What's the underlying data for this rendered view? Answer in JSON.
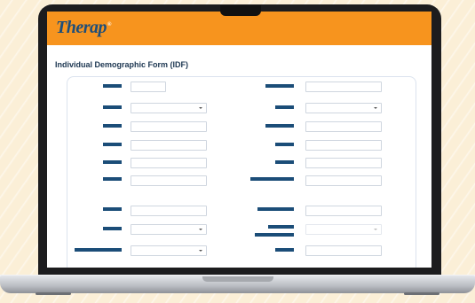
{
  "app": {
    "logo_text": "Therap",
    "logo_mark": "®"
  },
  "form": {
    "title": "Individual Demographic Form (IDF)"
  },
  "colors": {
    "header": "#f7941e",
    "label_bar": "#1b4d78",
    "title": "#1b3550",
    "background": "#fbefd7"
  }
}
